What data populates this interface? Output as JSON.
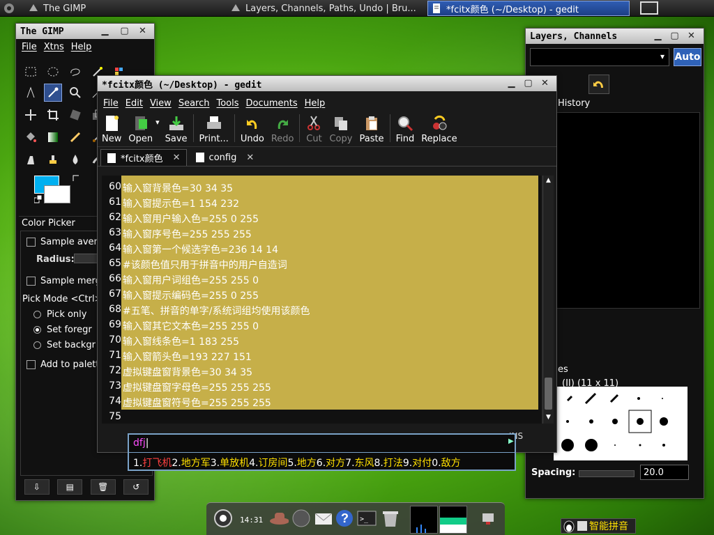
{
  "taskbar": {
    "tasks": [
      {
        "label": "The GIMP"
      },
      {
        "label": "Layers, Channels, Paths, Undo | Bru..."
      },
      {
        "label": "*fcitx颜色 (~/Desktop) - gedit",
        "active": true
      }
    ]
  },
  "gimp_toolbox": {
    "title": "The GIMP",
    "menu": [
      "File",
      "Xtns",
      "Help"
    ],
    "fg_color": "#00b0f0",
    "bg_color": "#ffffff",
    "panel_title": "Color Picker",
    "options": {
      "sample_average": "Sample aver",
      "radius_label": "Radius:",
      "sample_merged": "Sample merg",
      "pick_mode": "Pick Mode  <Ctrl>",
      "pick_only": "Pick only",
      "set_foreground": "Set foregr",
      "set_background": "Set backgr",
      "add_to_palette": "Add to palett"
    }
  },
  "gedit": {
    "title": "*fcitx颜色 (~/Desktop) - gedit",
    "menu": [
      "File",
      "Edit",
      "View",
      "Search",
      "Tools",
      "Documents",
      "Help"
    ],
    "toolbar": {
      "new": "New",
      "open": "Open",
      "save": "Save",
      "print": "Print...",
      "undo": "Undo",
      "redo": "Redo",
      "cut": "Cut",
      "copy": "Copy",
      "paste": "Paste",
      "find": "Find",
      "replace": "Replace"
    },
    "tabs": [
      {
        "label": "*fcitx颜色",
        "active": true
      },
      {
        "label": "config",
        "active": false
      }
    ],
    "lines": [
      {
        "no": "60",
        "text": "输入窗背景色=30 34 35"
      },
      {
        "no": "61",
        "text": "输入窗提示色=1 154 232"
      },
      {
        "no": "62",
        "text": "输入窗用户输入色=255 0 255"
      },
      {
        "no": "63",
        "text": "输入窗序号色=255 255 255"
      },
      {
        "no": "64",
        "text": "输入窗第一个候选字色=236 14 14"
      },
      {
        "no": "65",
        "text": "#该颜色值只用于拼音中的用户自造词"
      },
      {
        "no": "66",
        "text": "输入窗用户词组色=255 255 0"
      },
      {
        "no": "67",
        "text": "输入窗提示编码色=255 0 255"
      },
      {
        "no": "68",
        "text": "#五笔、拼音的单字/系统词组均使用该颜色"
      },
      {
        "no": "69",
        "text": "输入窗其它文本色=255 255 0"
      },
      {
        "no": "70",
        "text": "输入窗线条色=1 183 255"
      },
      {
        "no": "71",
        "text": "输入窗箭头色=193 227 151"
      },
      {
        "no": "72",
        "text": "虚拟键盘窗背景色=30 34 35"
      },
      {
        "no": "73",
        "text": "虚拟键盘窗字母色=255 255 255"
      },
      {
        "no": "74",
        "text": "虚拟键盘窗符号色=255 255 255"
      },
      {
        "no": "75",
        "text": ""
      }
    ],
    "selection_color": "#c6af49",
    "status_ins": "INS"
  },
  "layers_dock": {
    "title": "Layers, Channels",
    "auto_label": "Auto",
    "history_label": "History",
    "brushes_label": "es",
    "brush_name": "(II) (11 x 11)",
    "spacing_label": "Spacing:",
    "spacing_value": "20.0"
  },
  "ime": {
    "input": "dfj",
    "candidates": [
      {
        "num": "1.",
        "word": "打飞机"
      },
      {
        "num": "2.",
        "word": "地方军"
      },
      {
        "num": "3.",
        "word": "单放机"
      },
      {
        "num": "4.",
        "word": "订房间"
      },
      {
        "num": "5.",
        "word": "地方"
      },
      {
        "num": "6.",
        "word": "对方"
      },
      {
        "num": "7.",
        "word": "东风"
      },
      {
        "num": "8.",
        "word": "打法"
      },
      {
        "num": "9.",
        "word": "对付"
      },
      {
        "num": "0.",
        "word": "敌方"
      }
    ],
    "status_label": "智能拼音"
  },
  "dock": {
    "clock": "14:31"
  }
}
